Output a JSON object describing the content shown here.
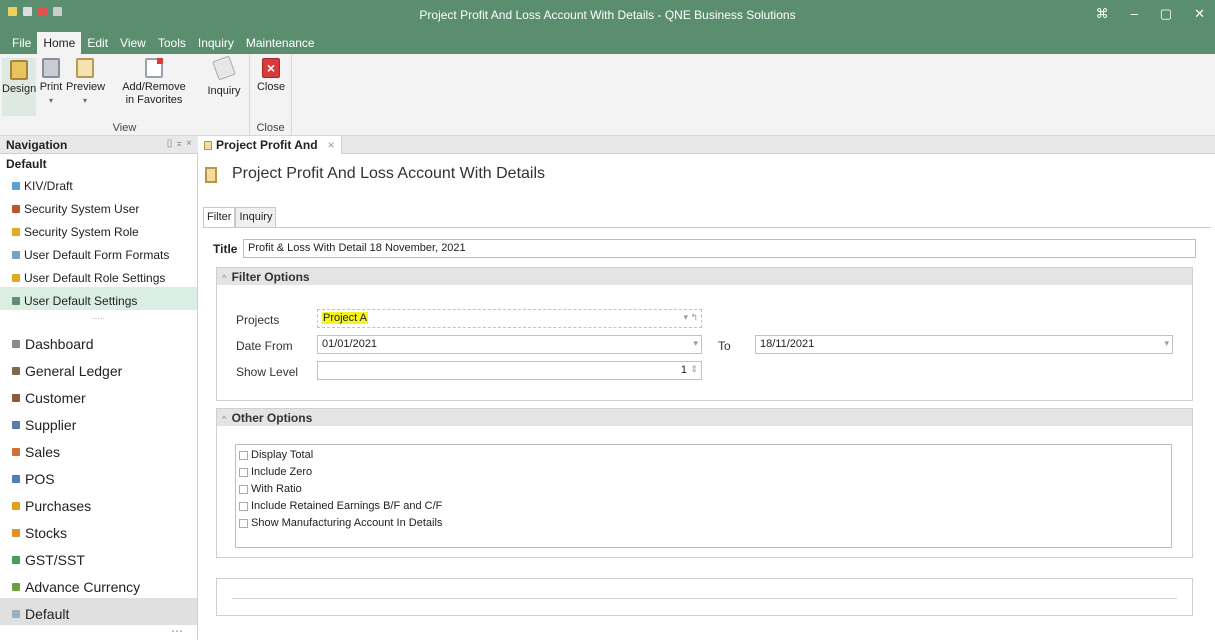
{
  "window": {
    "title": "Project Profit And Loss Account With Details - QNE Business Solutions",
    "controls": [
      "⌘",
      "–",
      "▢",
      "✕"
    ]
  },
  "menu": [
    "File",
    "Home",
    "Edit",
    "View",
    "Tools",
    "Inquiry",
    "Maintenance"
  ],
  "ribbon": {
    "view_group": {
      "label": "View",
      "design": "Design",
      "print": "Print",
      "preview": "Preview",
      "favorites_line1": "Add/Remove",
      "favorites_line2": "in Favorites",
      "inquiry": "Inquiry"
    },
    "close_group": {
      "label": "Close",
      "close": "Close"
    }
  },
  "navigation": {
    "header": "Navigation",
    "section": "Default",
    "items": [
      {
        "label": "KIV/Draft",
        "color": "#5a9fd4"
      },
      {
        "label": "Security System User",
        "color": "#c0552b"
      },
      {
        "label": "Security System Role",
        "color": "#e0a825"
      },
      {
        "label": "User Default Form Formats",
        "color": "#7aa0c8"
      },
      {
        "label": "User Default Role Settings",
        "color": "#e0a825"
      },
      {
        "label": "User Default Settings",
        "color": "#5f8f6f"
      }
    ],
    "modules": [
      {
        "label": "Dashboard",
        "color": "#8a8a8a"
      },
      {
        "label": "General Ledger",
        "color": "#7a6a4a"
      },
      {
        "label": "Customer",
        "color": "#8a5a3a"
      },
      {
        "label": "Supplier",
        "color": "#5a7ab0"
      },
      {
        "label": "Sales",
        "color": "#d07030"
      },
      {
        "label": "POS",
        "color": "#4a80c0"
      },
      {
        "label": "Purchases",
        "color": "#e0a020"
      },
      {
        "label": "Stocks",
        "color": "#e09020"
      },
      {
        "label": "GST/SST",
        "color": "#4a9a5a"
      },
      {
        "label": "Advance Currency",
        "color": "#6aa040"
      },
      {
        "label": "Default",
        "color": "#9ab0c0"
      }
    ],
    "more": "⋯"
  },
  "doc_tab": {
    "label": "Project Profit And",
    "close": "×"
  },
  "page": {
    "title": "Project Profit And Loss Account With Details",
    "tabs": [
      "Filter",
      "Inquiry"
    ],
    "title_label": "Title",
    "title_value": "Profit & Loss With Detail 18 November, 2021",
    "filter_options": {
      "header": "Filter Options",
      "projects_label": "Projects",
      "projects_value": "Project A",
      "date_from_label": "Date From",
      "date_from_value": "01/01/2021",
      "to_label": "To",
      "to_value": "18/11/2021",
      "show_level_label": "Show Level",
      "show_level_value": "1"
    },
    "other_options": {
      "header": "Other Options",
      "checkboxes": [
        "Display Total",
        "Include Zero",
        "With Ratio",
        "Include Retained Earnings B/F and C/F",
        "Show Manufacturing Account In Details"
      ]
    }
  },
  "colors": {
    "brand_green": "#5a8e6e",
    "highlight": "#f7f31e"
  }
}
